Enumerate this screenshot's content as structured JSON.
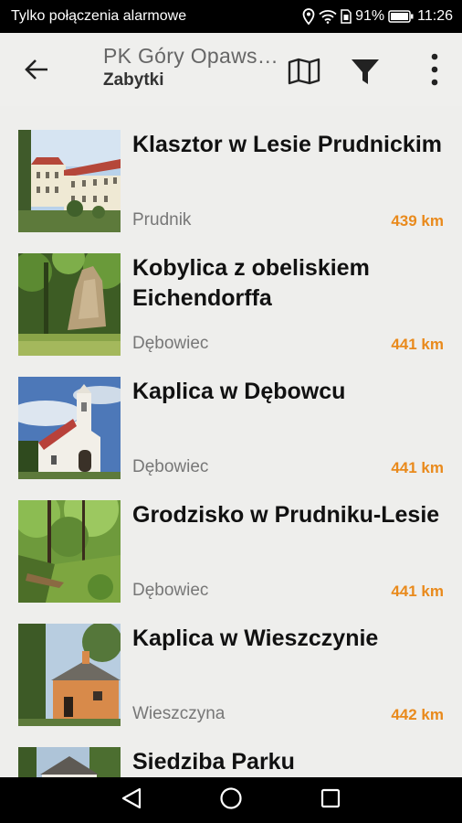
{
  "status": {
    "carrier": "Tylko połączenia alarmowe",
    "battery": "91%",
    "time": "11:26"
  },
  "appbar": {
    "title": "PK Góry Opawskie",
    "subtitle": "Zabytki"
  },
  "items": [
    {
      "title": "Klasztor w Lesie Prudnickim",
      "place": "Prudnik",
      "distance": "439 km"
    },
    {
      "title": "Kobylica z obeliskiem Eichendorffa",
      "place": "Dębowiec",
      "distance": "441 km"
    },
    {
      "title": "Kaplica w Dębowcu",
      "place": "Dębowiec",
      "distance": "441 km"
    },
    {
      "title": "Grodzisko w Prudniku-Lesie",
      "place": "Dębowiec",
      "distance": "441 km"
    },
    {
      "title": "Kaplica w Wieszczynie",
      "place": "Wieszczyna",
      "distance": "442 km"
    },
    {
      "title": "Siedziba Parku",
      "place": "",
      "distance": ""
    }
  ],
  "colors": {
    "accent": "#e98a1c",
    "background": "#eeeeec"
  }
}
